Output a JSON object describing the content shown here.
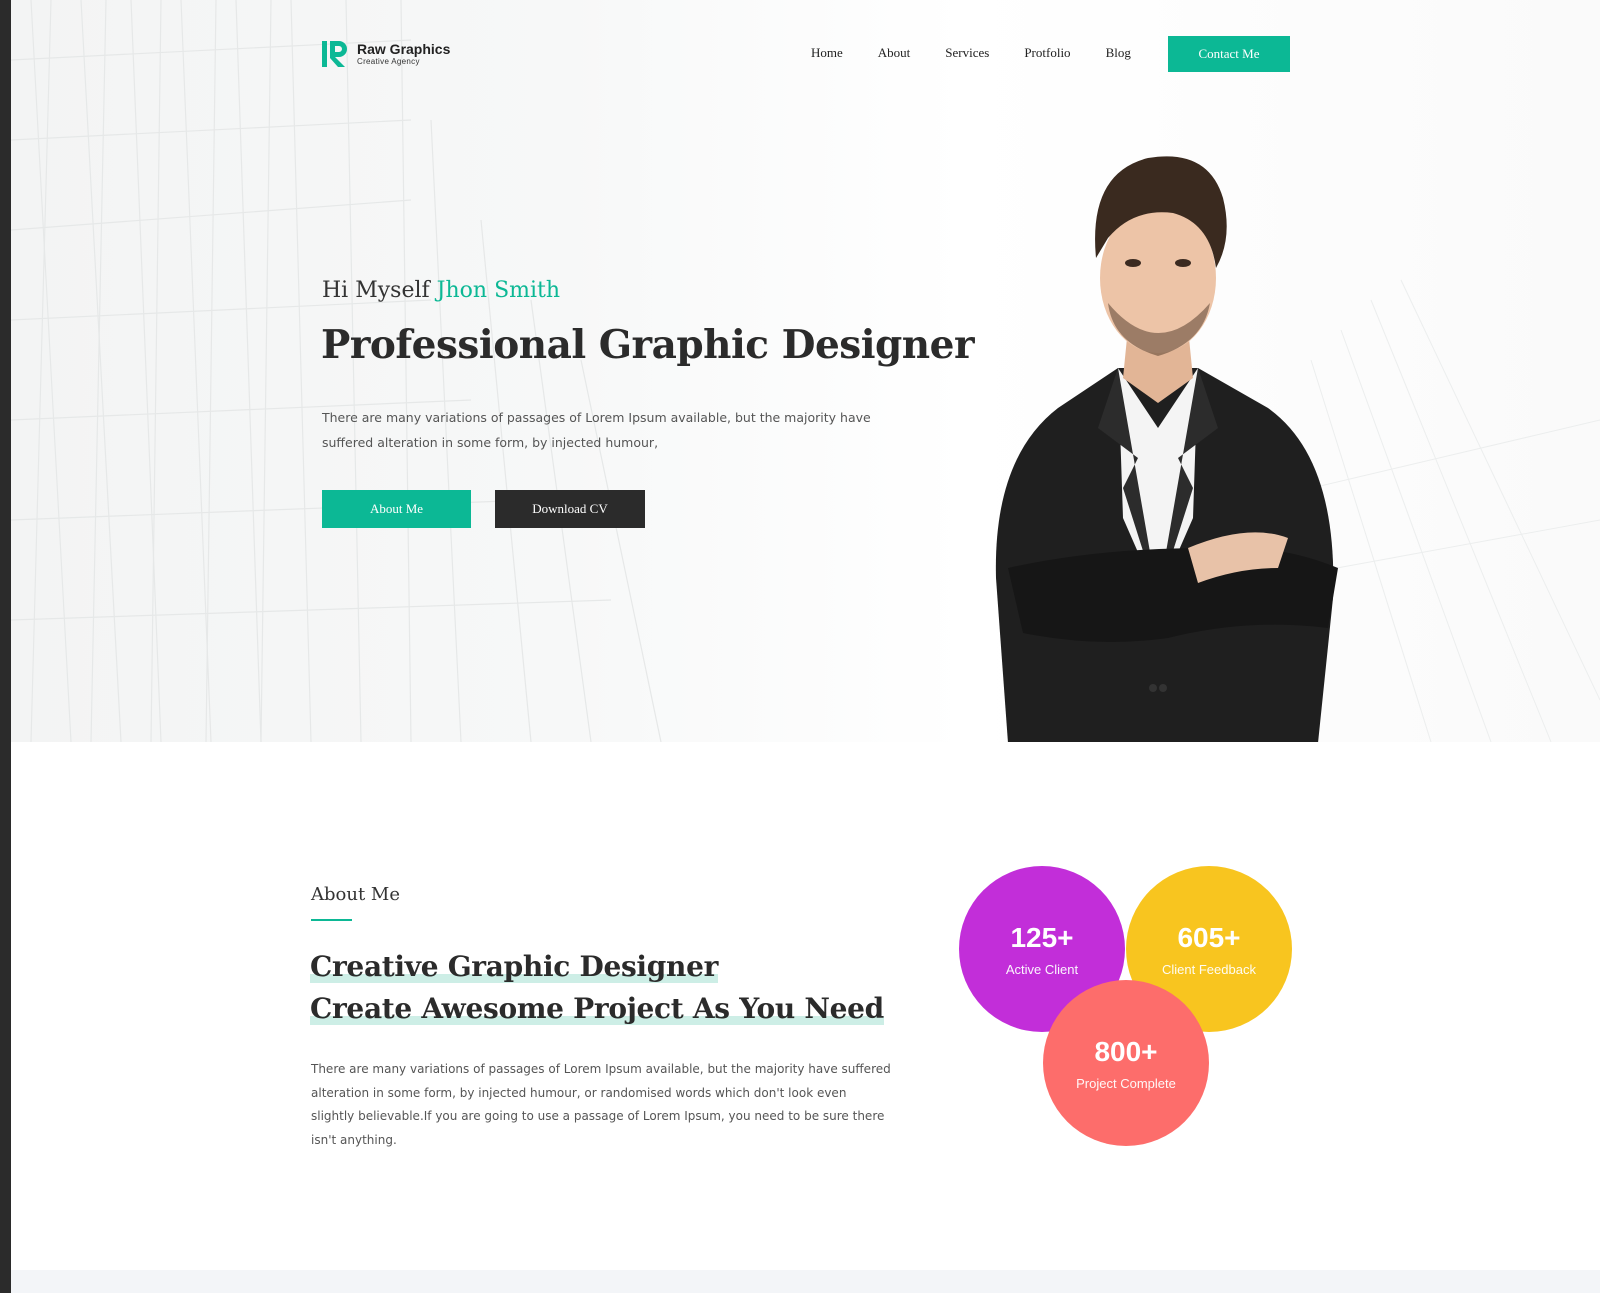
{
  "colors": {
    "accent": "#0cb895",
    "dark": "#2b2b2b",
    "stat_purple": "#c22ed9",
    "stat_yellow": "#f8c51f",
    "stat_coral": "#fd6d6b"
  },
  "brand": {
    "name": "Raw Graphics",
    "tagline": "Creative Agency",
    "logo_icon": "rg-logo-icon"
  },
  "nav": {
    "items": [
      "Home",
      "About",
      "Services",
      "Protfolio",
      "Blog"
    ],
    "contact_label": "Contact Me"
  },
  "hero": {
    "greeting": "Hi Myself",
    "name": "Jhon Smith",
    "title": "Professional Graphic Designer",
    "description": "There are many variations of passages of Lorem Ipsum available, but the majority have suffered alteration in some form, by injected humour,",
    "primary_button": "About Me",
    "secondary_button": "Download CV",
    "portrait": "man-in-black-suit-arms-crossed"
  },
  "about": {
    "label": "About Me",
    "heading_line1": "Creative Graphic Designer",
    "heading_line2": "Create Awesome Project As You Need",
    "description": "There are many variations of passages of Lorem Ipsum available, but the majority have suffered alteration in some form, by injected humour, or randomised words which don't look even slightly believable.If you are going to use a passage of Lorem Ipsum, you need to be sure there isn't anything."
  },
  "stats": [
    {
      "value": "125+",
      "label": "Active Client"
    },
    {
      "value": "605+",
      "label": "Client Feedback"
    },
    {
      "value": "800+",
      "label": "Project Complete"
    }
  ]
}
